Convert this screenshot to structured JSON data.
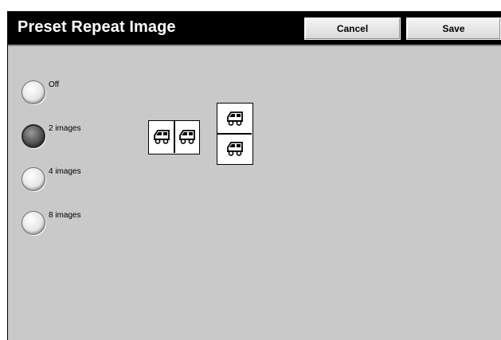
{
  "header": {
    "title": "Preset Repeat Image",
    "cancel_label": "Cancel",
    "save_label": "Save"
  },
  "options": [
    {
      "label": "Off",
      "selected": false
    },
    {
      "label": "2 images",
      "selected": true
    },
    {
      "label": "4 images",
      "selected": false
    },
    {
      "label": "8 images",
      "selected": false
    }
  ],
  "preview": {
    "horizontal_icon": "van-icon",
    "vertical_icon": "van-icon"
  },
  "colors": {
    "titlebar": "#000000",
    "panel": "#c9c9c9",
    "selected_radio": "#4a4a4a"
  }
}
